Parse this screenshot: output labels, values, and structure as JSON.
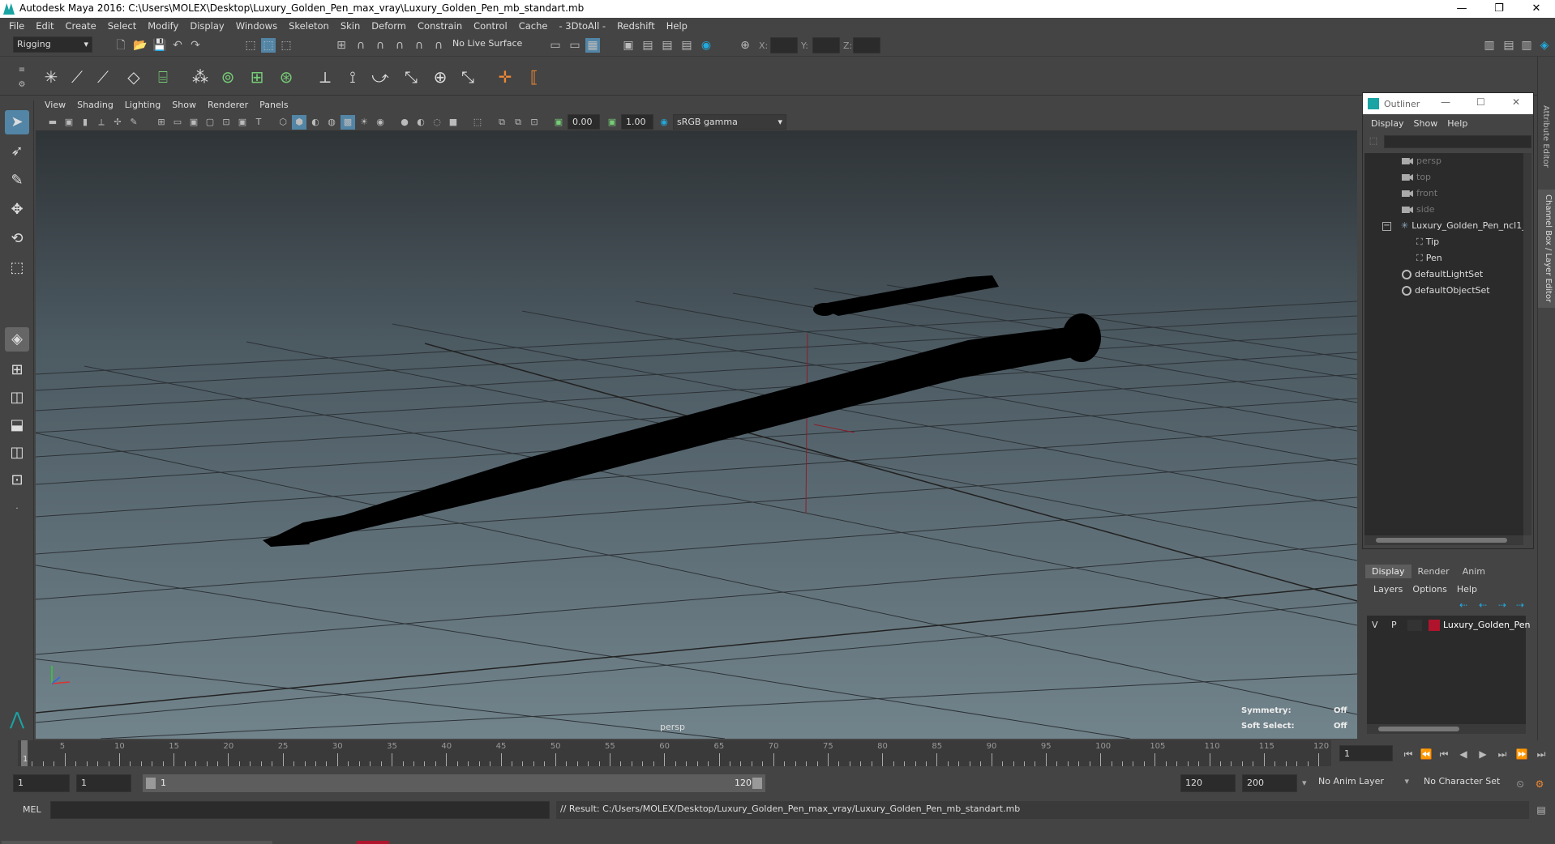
{
  "window": {
    "title": "Autodesk Maya 2016: C:\\Users\\MOLEX\\Desktop\\Luxury_Golden_Pen_max_vray\\Luxury_Golden_Pen_mb_standart.mb",
    "minimize": "—",
    "restore": "❐",
    "close": "✕"
  },
  "menubar": [
    "File",
    "Edit",
    "Create",
    "Select",
    "Modify",
    "Display",
    "Windows",
    "Skeleton",
    "Skin",
    "Deform",
    "Constrain",
    "Control",
    "Cache",
    "- 3DtoAll -",
    "Redshift",
    "Help"
  ],
  "status": {
    "menuset": "Rigging",
    "live_surface": "No Live Surface",
    "x_label": "X:",
    "y_label": "Y:",
    "z_label": "Z:"
  },
  "viewport": {
    "menu": [
      "View",
      "Shading",
      "Lighting",
      "Show",
      "Renderer",
      "Panels"
    ],
    "exposure": "0.00",
    "gamma": "1.00",
    "colorspace": "sRGB gamma",
    "camera_label": "persp",
    "symmetry_label": "Symmetry:",
    "symmetry_value": "Off",
    "softselect_label": "Soft Select:",
    "softselect_value": "Off"
  },
  "outliner": {
    "title": "Outliner",
    "menu": [
      "Display",
      "Show",
      "Help"
    ],
    "items": [
      {
        "label": "persp",
        "type": "camera",
        "dim": true
      },
      {
        "label": "top",
        "type": "camera",
        "dim": true
      },
      {
        "label": "front",
        "type": "camera",
        "dim": true
      },
      {
        "label": "side",
        "type": "camera",
        "dim": true
      },
      {
        "label": "Luxury_Golden_Pen_ncl1_",
        "type": "group",
        "dim": false
      },
      {
        "label": "Tip",
        "type": "mesh",
        "dim": false
      },
      {
        "label": "Pen",
        "type": "mesh",
        "dim": false
      },
      {
        "label": "defaultLightSet",
        "type": "set",
        "dim": false
      },
      {
        "label": "defaultObjectSet",
        "type": "set",
        "dim": false
      }
    ]
  },
  "layers": {
    "tabs": [
      "Display",
      "Render",
      "Anim"
    ],
    "menu": [
      "Layers",
      "Options",
      "Help"
    ],
    "row": {
      "v": "V",
      "p": "P",
      "name": "Luxury_Golden_Pen",
      "color": "#b0142c"
    }
  },
  "rightstrip": {
    "attr": "Attribute Editor",
    "channel": "Channel Box / Layer Editor"
  },
  "timeline": {
    "ticks": [
      "5",
      "10",
      "15",
      "20",
      "25",
      "30",
      "35",
      "40",
      "45",
      "50",
      "55",
      "60",
      "65",
      "70",
      "75",
      "80",
      "85",
      "90",
      "95",
      "100",
      "105",
      "110",
      "115",
      "120"
    ],
    "start_marker": "1",
    "current_frame": "1"
  },
  "range": {
    "start": "1",
    "playback_start": "1",
    "slider_start": "1",
    "slider_end": "120",
    "playback_end": "120",
    "end": "200",
    "anim_layer": "No Anim Layer",
    "char_set": "No Character Set"
  },
  "cmd": {
    "lang": "MEL",
    "result": "// Result: C:/Users/MOLEX/Desktop/Luxury_Golden_Pen_max_vray/Luxury_Golden_Pen_mb_standart.mb"
  }
}
